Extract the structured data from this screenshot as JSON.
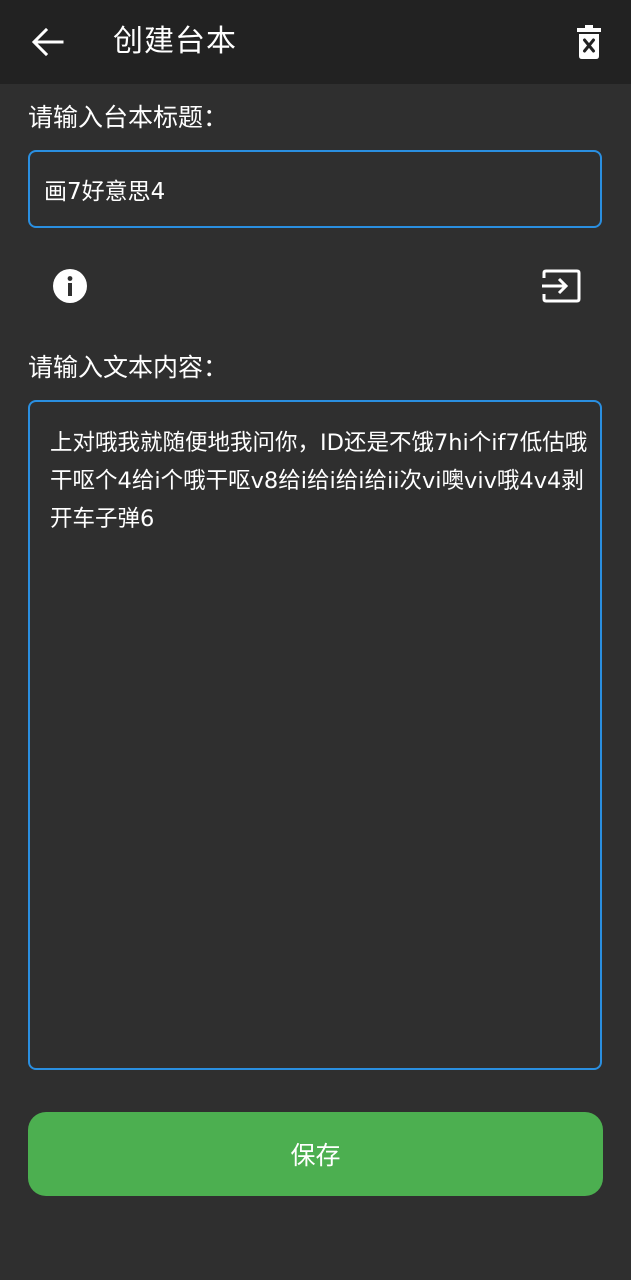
{
  "app_bar": {
    "title": "创建台本",
    "back_icon": "arrow-left-icon",
    "delete_icon": "trash-icon"
  },
  "form": {
    "title_label": "请输入台本标题：",
    "title_value": "画7好意思4",
    "content_label": "请输入文本内容：",
    "content_value": "上对哦我就随便地我问你，ID还是不饿7hi个if7低估哦干呕个4给i个哦干呕v8给i给i给i给ii次vi噢viv哦4v4剥开车子弹6"
  },
  "toolbar": {
    "info_icon": "info-icon",
    "import_icon": "import-icon"
  },
  "actions": {
    "save_label": "保存"
  },
  "colors": {
    "background": "#2f2f2f",
    "app_bar": "#222222",
    "input_border": "#2a8fe0",
    "save_button": "#4caf50"
  }
}
